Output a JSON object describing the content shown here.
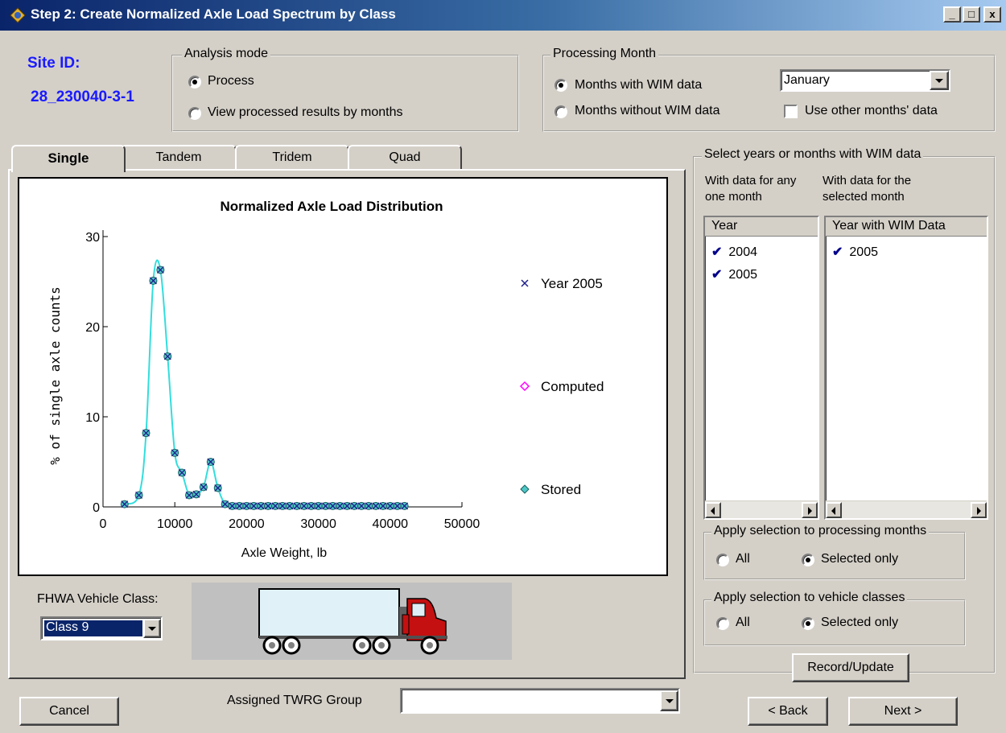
{
  "window": {
    "title": "Step 2: Create Normalized Axle Load Spectrum by Class",
    "controls": [
      "_",
      "□",
      "x"
    ]
  },
  "site": {
    "label": "Site ID:",
    "value": "28_230040-3-1"
  },
  "analysis_mode": {
    "label": "Analysis mode",
    "options": [
      "Process",
      "View processed results by months"
    ],
    "selected": "Process"
  },
  "processing_month": {
    "label": "Processing Month",
    "options": [
      "Months with WIM data",
      "Months without WIM data"
    ],
    "selected": "Months with WIM data",
    "month": "January",
    "use_other_label": "Use other months' data",
    "use_other_checked": false
  },
  "tabs": {
    "items": [
      "Single",
      "Tandem",
      "Tridem",
      "Quad"
    ],
    "active": "Single"
  },
  "chart_data": {
    "type": "scatter",
    "title": "Normalized Axle Load Distribution",
    "xlabel": "Axle Weight, lb",
    "ylabel": "% of single axle counts",
    "xlim": [
      0,
      50000
    ],
    "ylim": [
      0,
      30
    ],
    "xticks": [
      0,
      10000,
      20000,
      30000,
      40000,
      50000
    ],
    "yticks": [
      0,
      10,
      20,
      30
    ],
    "legend_position": "right",
    "series": [
      {
        "name": "Year 2005",
        "marker": "x",
        "color": "#1e1e8c"
      },
      {
        "name": "Computed",
        "marker": "diamond",
        "color": "#ff00ff"
      },
      {
        "name": "Stored",
        "marker": "circle",
        "color": "#4fc6c6"
      }
    ],
    "x": [
      3000,
      5000,
      6000,
      7000,
      8000,
      9000,
      10000,
      11000,
      12000,
      13000,
      14000,
      15000,
      16000,
      17000,
      18000,
      19000,
      20000,
      21000,
      22000,
      23000,
      24000,
      25000,
      26000,
      27000,
      28000,
      29000,
      30000,
      31000,
      32000,
      33000,
      34000,
      35000,
      36000,
      37000,
      38000,
      39000,
      40000,
      41000,
      42000
    ],
    "y": [
      0.3,
      1.3,
      8.2,
      25.1,
      26.3,
      16.7,
      6.0,
      3.8,
      1.3,
      1.4,
      2.2,
      5.0,
      2.1,
      0.3,
      0.1,
      0.1,
      0.1,
      0.1,
      0.1,
      0.1,
      0.1,
      0.1,
      0.1,
      0.1,
      0.1,
      0.1,
      0.1,
      0.1,
      0.1,
      0.1,
      0.1,
      0.1,
      0.1,
      0.1,
      0.1,
      0.1,
      0.1,
      0.1,
      0.1
    ]
  },
  "vehicle_class": {
    "label": "FHWA Vehicle Class:",
    "selected": "Class 9"
  },
  "twrg": {
    "label": "Assigned TWRG Group",
    "value": ""
  },
  "select_years": {
    "label": "Select years or months with WIM data",
    "col1_caption": "With data for any one month",
    "col2_caption": "With data for the selected month",
    "list1": {
      "header": "Year",
      "items": [
        "2004",
        "2005"
      ]
    },
    "list2": {
      "header": "Year with WIM Data",
      "items": [
        "2005"
      ]
    }
  },
  "apply_months": {
    "label": "Apply selection to processing months",
    "options": [
      "All",
      "Selected only"
    ],
    "selected": "Selected only"
  },
  "apply_classes": {
    "label": "Apply selection to vehicle classes",
    "options": [
      "All",
      "Selected only"
    ],
    "selected": "Selected only"
  },
  "buttons": {
    "record_update": "Record/Update",
    "back": "< Back",
    "next": "Next >",
    "cancel": "Cancel"
  },
  "colors": {
    "title_start": "#0a246a",
    "title_end": "#a6caf0",
    "site_blue": "#1a1aff",
    "curve": "#33dddd",
    "marker": "#4fc6c6"
  }
}
